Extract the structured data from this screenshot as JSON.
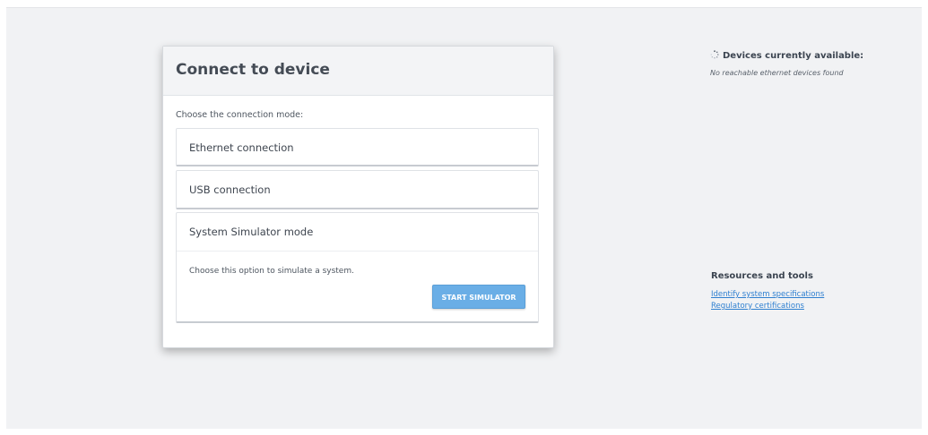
{
  "connect_card": {
    "title": "Connect to device",
    "mode_label": "Choose the connection mode:",
    "options": [
      {
        "label": "Ethernet connection"
      },
      {
        "label": "USB connection"
      },
      {
        "label": "System Simulator mode",
        "description": "Choose this option to simulate a system.",
        "button_label": "START SIMULATOR"
      }
    ]
  },
  "devices_panel": {
    "icon": "spinner-icon",
    "title": "Devices currently available:",
    "empty_message": "No reachable ethernet devices found"
  },
  "resources_panel": {
    "title": "Resources and tools",
    "links": [
      {
        "label": "Identify system specifications"
      },
      {
        "label": "Regulatory certifications"
      }
    ]
  },
  "colors": {
    "background": "#f1f2f4",
    "accent_button": "#6aaee6",
    "link": "#2e7fd0"
  }
}
